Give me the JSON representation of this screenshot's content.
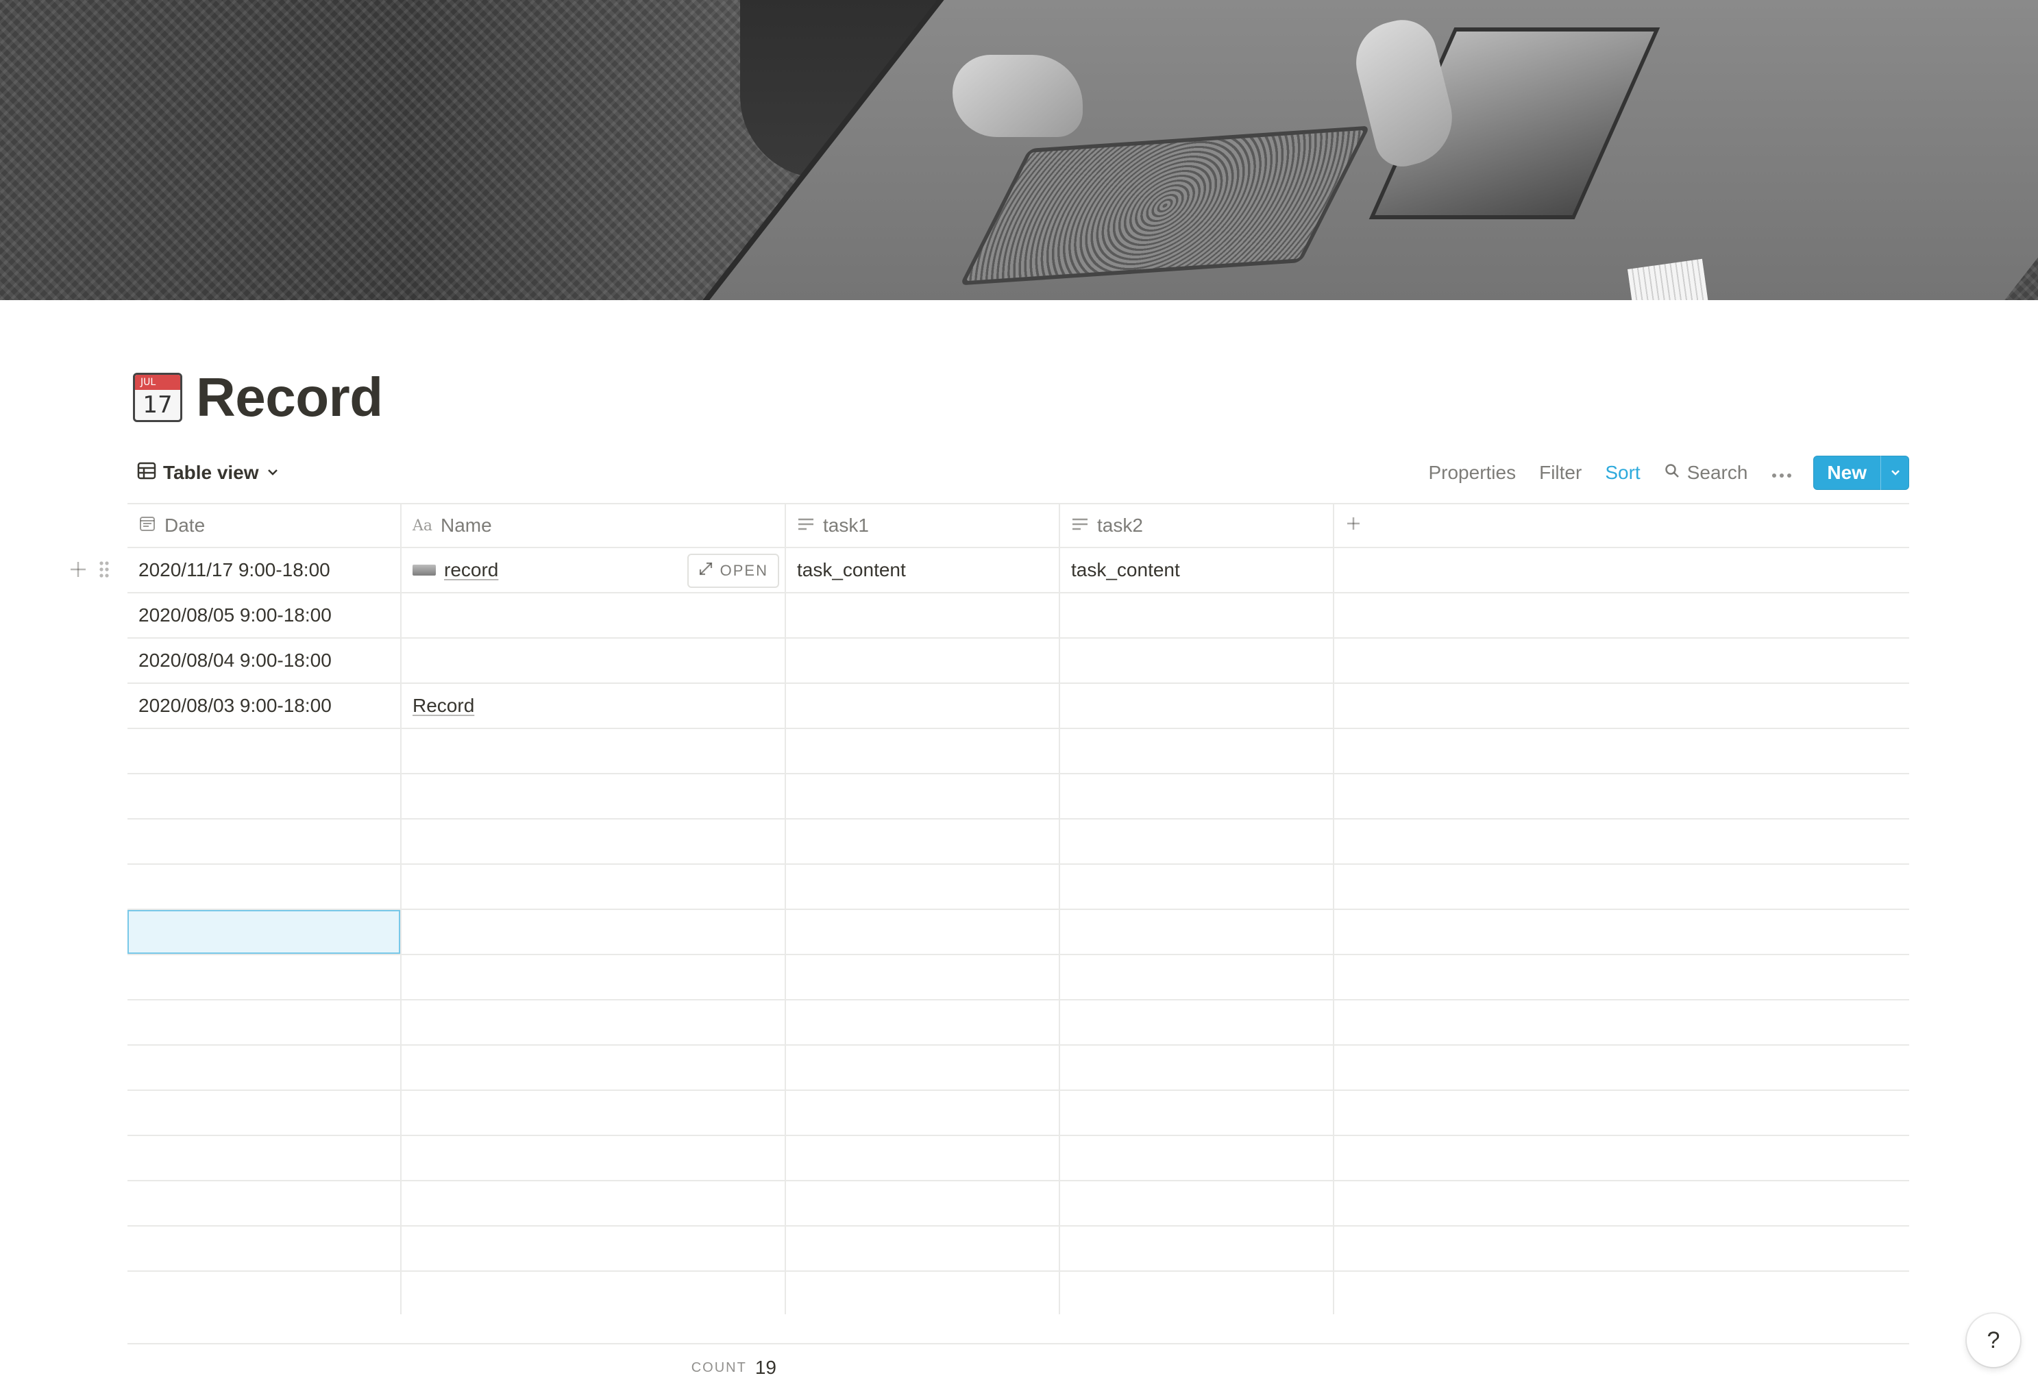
{
  "page": {
    "title": "Record",
    "icon": "calendar-icon",
    "icon_month": "JUL",
    "icon_day": "17"
  },
  "toolbar": {
    "view_label": "Table view",
    "properties": "Properties",
    "filter": "Filter",
    "sort": "Sort",
    "search": "Search",
    "new_label": "New",
    "accent_color": "#2EAADC"
  },
  "table": {
    "columns": [
      {
        "label": "Date",
        "icon": "calendar-property-icon"
      },
      {
        "label": "Name",
        "icon": "title-property-icon"
      },
      {
        "label": "task1",
        "icon": "text-property-icon"
      },
      {
        "label": "task2",
        "icon": "text-property-icon"
      }
    ],
    "rows": [
      {
        "date": "2020/11/17 9:00-18:00",
        "name": "record",
        "task1": "task_content",
        "task2": "task_content"
      },
      {
        "date": "2020/08/05 9:00-18:00",
        "name": "",
        "task1": "",
        "task2": ""
      },
      {
        "date": "2020/08/04 9:00-18:00",
        "name": "",
        "task1": "",
        "task2": ""
      },
      {
        "date": "2020/08/03 9:00-18:00",
        "name": "Record",
        "task1": "",
        "task2": ""
      }
    ],
    "open_label": "OPEN",
    "count_label": "COUNT",
    "count_value": "19"
  },
  "help": {
    "label": "?"
  }
}
